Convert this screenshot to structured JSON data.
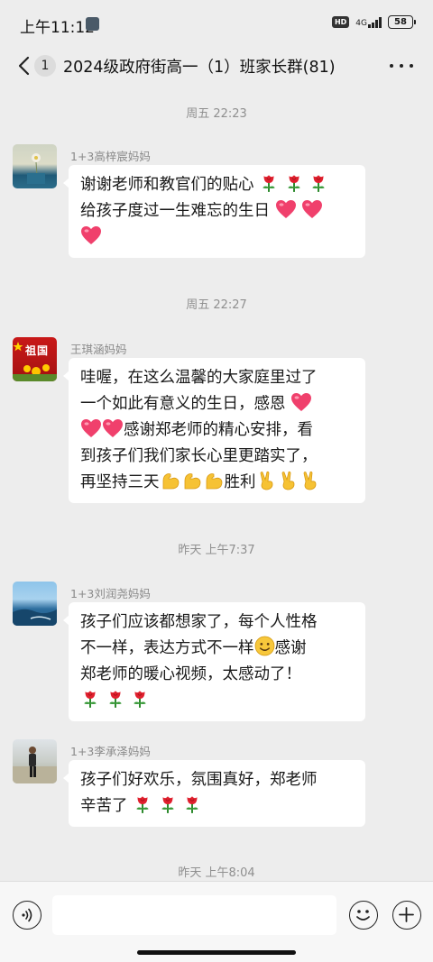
{
  "status_bar": {
    "time": "上午11:12",
    "network": "4G",
    "battery": "58"
  },
  "header": {
    "unread_count": "1",
    "title": "2024级政府街高一（1）班家长群(81)"
  },
  "messages": [
    {
      "timestamp": "周五 22:23",
      "sender": "1+3高梓宸妈妈",
      "lines": [
        "谢谢老师和教官们的贴心",
        "给孩子度过一生难忘的生日",
        ""
      ]
    },
    {
      "timestamp": "周五 22:27",
      "sender": "王琪涵妈妈",
      "avatar_text": "祖国",
      "lines": [
        "哇喔，在这么温馨的大家庭里过了",
        "一个如此有意义的生日，感恩",
        "感谢郑老师的精心安排，看",
        "到孩子们我们家长心里更踏实了，",
        "再坚持三天",
        "胜利"
      ]
    },
    {
      "timestamp": "昨天 上午7:37",
      "sender": "1+3刘润尧妈妈",
      "lines": [
        "孩子们应该都想家了，每个人性格",
        "不一样，表达方式不一样",
        "感谢",
        "郑老师的暖心视频，太感动了！"
      ]
    },
    {
      "sender": "1+3李承泽妈妈",
      "lines": [
        "孩子们好欢乐，氛围真好，郑老师",
        "辛苦了"
      ]
    }
  ],
  "last_timestamp": "昨天 上午8:04",
  "input": {
    "placeholder": ""
  },
  "icons": [
    "back-icon",
    "more-icon",
    "rose-icon",
    "heart-icon",
    "muscle-icon",
    "victory-icon",
    "smile-icon",
    "voice-icon",
    "emoji-icon",
    "plus-icon"
  ]
}
